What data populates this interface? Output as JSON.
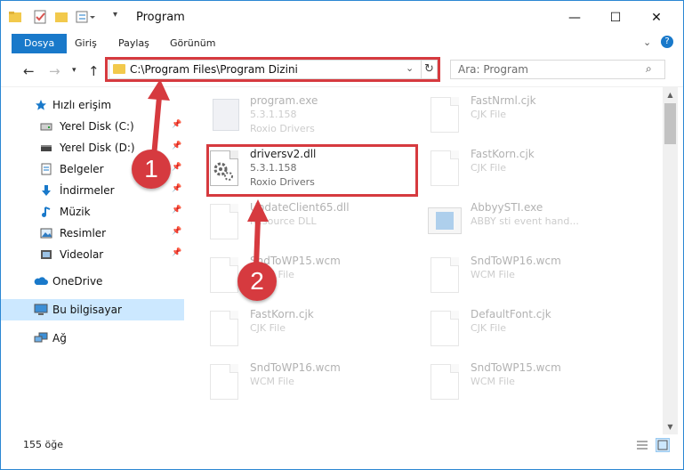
{
  "window": {
    "title": "Program"
  },
  "ribbon": {
    "tabs": [
      "Dosya",
      "Giriş",
      "Paylaş",
      "Görünüm"
    ]
  },
  "address": {
    "path": "C:\\Program Files\\Program Dizini",
    "search_placeholder": "Ara: Program"
  },
  "nav": {
    "items": [
      {
        "label": "Hızlı erişim",
        "icon": "star-icon",
        "pinned": false
      },
      {
        "label": "Yerel Disk (C:)",
        "icon": "drive-icon",
        "pinned": true
      },
      {
        "label": "Yerel Disk (D:)",
        "icon": "drive-icon",
        "pinned": true
      },
      {
        "label": "Belgeler",
        "icon": "documents-icon",
        "pinned": true
      },
      {
        "label": "İndirmeler",
        "icon": "download-icon",
        "pinned": true
      },
      {
        "label": "Müzik",
        "icon": "music-icon",
        "pinned": true
      },
      {
        "label": "Resimler",
        "icon": "pictures-icon",
        "pinned": true
      },
      {
        "label": "Videolar",
        "icon": "videos-icon",
        "pinned": true
      },
      {
        "label": "OneDrive",
        "icon": "cloud-icon",
        "pinned": false
      },
      {
        "label": "Bu bilgisayar",
        "icon": "computer-icon",
        "pinned": false
      },
      {
        "label": "Ağ",
        "icon": "network-icon",
        "pinned": false
      }
    ]
  },
  "files": [
    {
      "name": "program.exe",
      "line2": "5.3.1.158",
      "line3": "Roxio Drivers",
      "faded": true
    },
    {
      "name": "FastNrml.cjk",
      "line2": "CJK File",
      "line3": "",
      "faded": true
    },
    {
      "name": "driversv2.dll",
      "line2": "5.3.1.158",
      "line3": "Roxio Drivers",
      "faded": false
    },
    {
      "name": "FastKorn.cjk",
      "line2": "CJK File",
      "line3": "",
      "faded": true
    },
    {
      "name": "UpdateClient65.dll",
      "line2": "Resource DLL",
      "line3": "",
      "faded": true
    },
    {
      "name": "AbbyySTI.exe",
      "line2": "ABBY sti event hand...",
      "line3": "",
      "faded": true
    },
    {
      "name": "SndToWP15.wcm",
      "line2": "WCM File",
      "line3": "",
      "faded": true
    },
    {
      "name": "SndToWP16.wcm",
      "line2": "WCM File",
      "line3": "",
      "faded": true
    },
    {
      "name": "FastKorn.cjk",
      "line2": "CJK File",
      "line3": "",
      "faded": true
    },
    {
      "name": "DefaultFont.cjk",
      "line2": "CJK File",
      "line3": "",
      "faded": true
    },
    {
      "name": "SndToWP16.wcm",
      "line2": "WCM File",
      "line3": "",
      "faded": true
    },
    {
      "name": "SndToWP15.wcm",
      "line2": "WCM File",
      "line3": "",
      "faded": true
    }
  ],
  "status": {
    "count": "155 öğe"
  },
  "callouts": {
    "one": "1",
    "two": "2"
  },
  "colors": {
    "accent": "#1979ca",
    "highlight": "#d63a3f",
    "selected": "#cce8ff"
  }
}
